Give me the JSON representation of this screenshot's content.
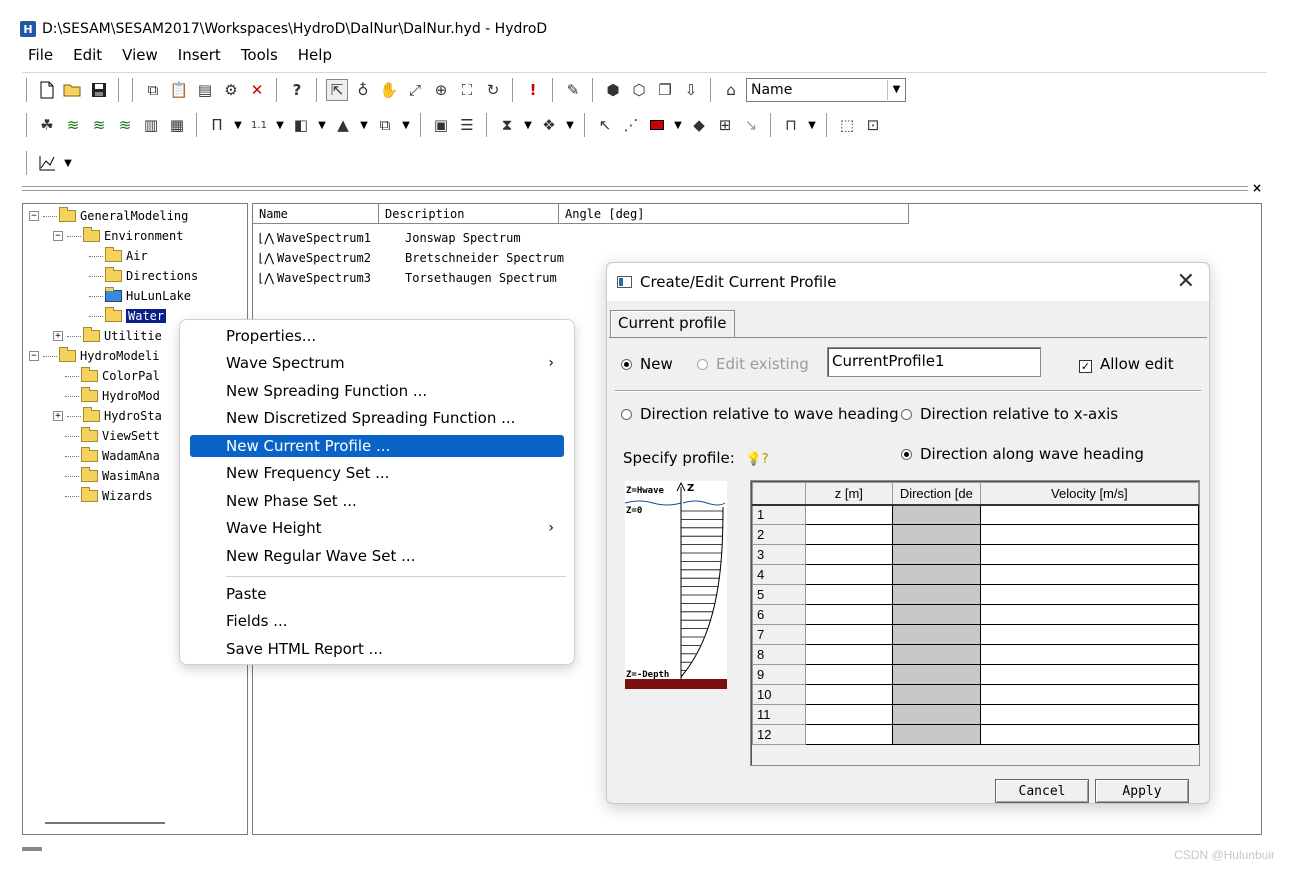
{
  "window": {
    "title": "D:\\SESAM\\SESAM2017\\Workspaces\\HydroD\\DalNur\\DalNur.hyd - HydroD"
  },
  "menu": [
    "File",
    "Edit",
    "View",
    "Insert",
    "Tools",
    "Help"
  ],
  "toolbar": {
    "name_combo_value": "Name"
  },
  "tree": {
    "nodes": [
      "GeneralModeling",
      "Environment",
      "Air",
      "Directions",
      "HuLunLake",
      "Water",
      "Utilitie",
      "HydroModeli",
      "ColorPal",
      "HydroMod",
      "HydroSta",
      "ViewSett",
      "WadamAna",
      "WasimAna",
      "Wizards"
    ]
  },
  "list": {
    "headers": [
      "Name",
      "Description",
      "Angle [deg]"
    ],
    "rows": [
      {
        "name": "WaveSpectrum1",
        "description": "Jonswap Spectrum"
      },
      {
        "name": "WaveSpectrum2",
        "description": "Bretschneider Spectrum"
      },
      {
        "name": "WaveSpectrum3",
        "description": "Torsethaugen Spectrum"
      }
    ]
  },
  "context_menu": {
    "items": [
      "Properties...",
      "Wave Spectrum",
      "New Spreading Function ...",
      "New Discretized Spreading Function ...",
      "New Current Profile ...",
      "New Frequency Set ...",
      "New Phase Set ...",
      "Wave Height",
      "New Regular Wave Set ...",
      "Paste",
      "Fields ...",
      "Save HTML Report ..."
    ],
    "highlighted": "New Current Profile ..."
  },
  "dialog": {
    "title": "Create/Edit Current Profile",
    "tab": "Current profile",
    "new_label": "New",
    "edit_existing_label": "Edit existing",
    "profile_name": "CurrentProfile1",
    "allow_edit_label": "Allow edit",
    "dir_relative_wave": "Direction relative to wave heading",
    "dir_relative_x": "Direction relative to x-axis",
    "specify_profile": "Specify profile:",
    "dir_along_wave": "Direction along wave heading",
    "figure": {
      "top_label": "Z=Hwave",
      "zero_label": "Z=0",
      "bottom_label": "Z=-Depth",
      "axis_label": "Z"
    },
    "grid_headers": [
      "z [m]",
      "Direction [de",
      "Velocity [m/s]"
    ],
    "rows": [
      "1",
      "2",
      "3",
      "4",
      "5",
      "6",
      "7",
      "8",
      "9",
      "10",
      "11",
      "12"
    ],
    "cancel_label": "Cancel",
    "apply_label": "Apply"
  },
  "watermark": "CSDN @Hulunbuir"
}
